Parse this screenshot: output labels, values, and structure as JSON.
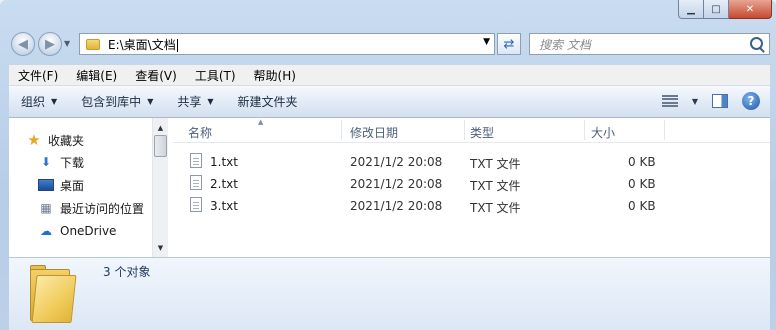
{
  "address": {
    "path": "E:\\桌面\\文档"
  },
  "search": {
    "placeholder": "搜索 文档"
  },
  "menu": [
    "文件(F)",
    "编辑(E)",
    "查看(V)",
    "工具(T)",
    "帮助(H)"
  ],
  "toolbar": {
    "organize": "组织",
    "include_library": "包含到库中",
    "share": "共享",
    "new_folder": "新建文件夹"
  },
  "nav": {
    "favorites": "收藏夹",
    "downloads": "下载",
    "desktop": "桌面",
    "recent": "最近访问的位置",
    "onedrive": "OneDrive"
  },
  "columns": {
    "name": "名称",
    "modified": "修改日期",
    "type": "类型",
    "size": "大小"
  },
  "files": [
    {
      "name": "1.txt",
      "modified": "2021/1/2 20:08",
      "type": "TXT 文件",
      "size": "0 KB"
    },
    {
      "name": "2.txt",
      "modified": "2021/1/2 20:08",
      "type": "TXT 文件",
      "size": "0 KB"
    },
    {
      "name": "3.txt",
      "modified": "2021/1/2 20:08",
      "type": "TXT 文件",
      "size": "0 KB"
    }
  ],
  "details": {
    "count": "3 个对象"
  }
}
